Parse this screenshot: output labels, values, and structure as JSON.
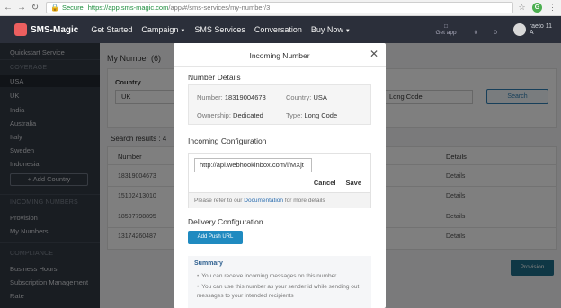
{
  "browser": {
    "secure_label": "Secure",
    "url_host": "https://app.sms-magic.com",
    "url_path": "/app/#/sms-services/my-number/3"
  },
  "topnav": {
    "brand": "SMS-Magic",
    "items": [
      "Get Started",
      "Campaign",
      "SMS Services",
      "Conversation",
      "Buy Now"
    ],
    "get_app": "Get app",
    "stat_value": "0",
    "stat_value_2": "0",
    "user_name": "raeto 11",
    "user_sub": "A"
  },
  "sidebar": {
    "quickstart": "Quickstart Service",
    "coverage_heading": "COVERAGE",
    "countries": [
      "USA",
      "UK",
      "India",
      "Australia",
      "Italy",
      "Sweden",
      "Indonesia"
    ],
    "add_country": "+ Add Country",
    "incoming_heading": "INCOMING NUMBERS",
    "provision": "Provision",
    "my_numbers": "My Numbers",
    "compliance_heading": "COMPLIANCE",
    "business_hours": "Business Hours",
    "subscription": "Subscription Management",
    "rate": "Rate"
  },
  "page": {
    "title": "My Number (6)",
    "country_label": "Country",
    "country_value": "UK",
    "type_value": "Long Code",
    "search_button": "Search",
    "results_label": "Search results : 4",
    "col_number": "Number",
    "col_details": "Details",
    "rows": [
      {
        "number": "18319004673",
        "details": "Details"
      },
      {
        "number": "15102413010",
        "details": "Details"
      },
      {
        "number": "18507798895",
        "details": "Details"
      },
      {
        "number": "13174260487",
        "details": "Details"
      }
    ],
    "provision_button": "Provision"
  },
  "modal": {
    "title": "Incoming Number",
    "number_details_heading": "Number Details",
    "number_label": "Number:",
    "number_value": "18319004673",
    "country_label": "Country:",
    "country_value": "USA",
    "ownership_label": "Ownership:",
    "ownership_value": "Dedicated",
    "type_label": "Type:",
    "type_value": "Long Code",
    "incoming_config_heading": "Incoming Configuration",
    "webhook_url": "http://api.webhookinbox.com/i/MXjt",
    "cancel_label": "Cancel",
    "save_label": "Save",
    "note_prefix": "Please refer to our",
    "note_link": "Documentation",
    "note_suffix": "for more details",
    "delivery_heading": "Delivery Configuration",
    "add_push_url": "Add Push URL",
    "summary_title": "Summary",
    "summary_items": [
      "You can receive incoming messages on this number.",
      "You can use this number as your sender id while sending out messages to your intended recipients"
    ]
  }
}
